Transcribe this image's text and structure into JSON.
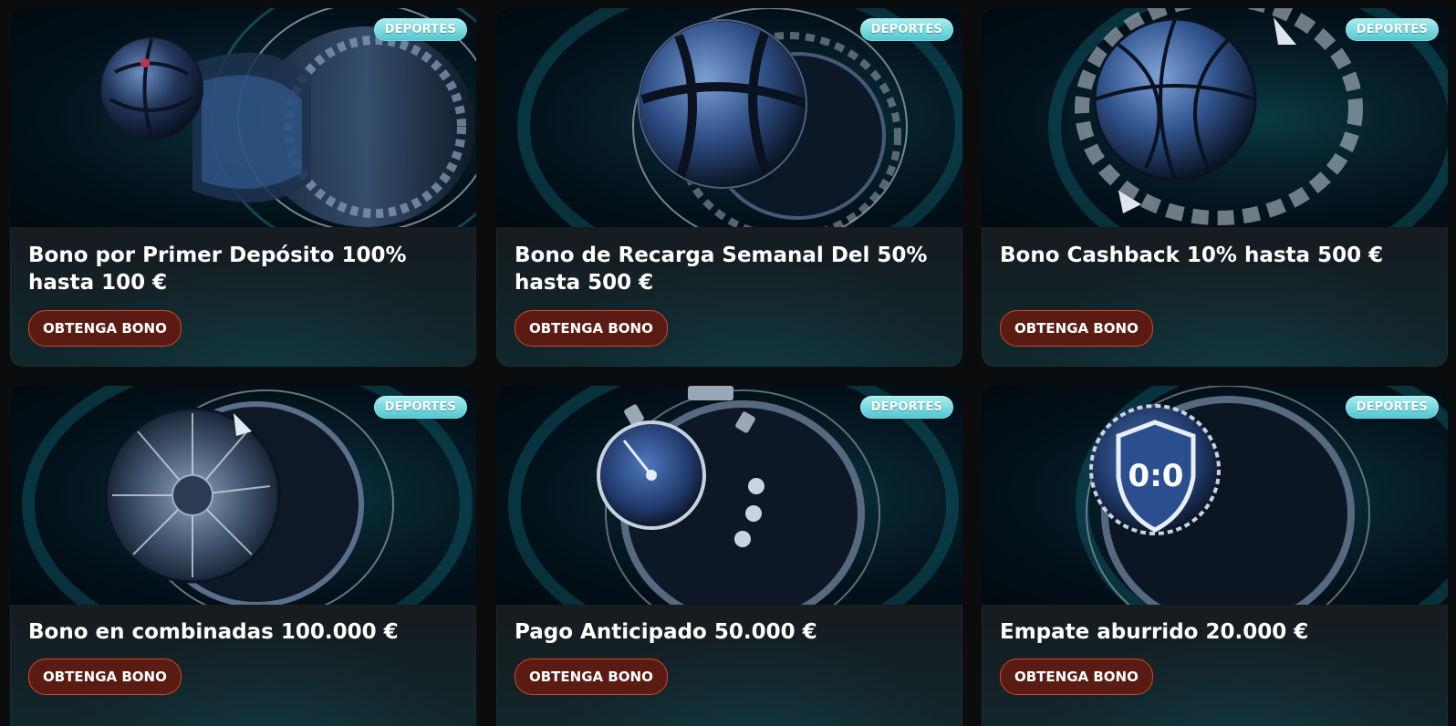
{
  "cards": [
    {
      "badge": "DEPORTES",
      "title": "Bono por Primer Depósito 100% hasta 100 €",
      "button": "OBTENGA BONO",
      "art_icon": "soccer-ball-roulette-icon"
    },
    {
      "badge": "DEPORTES",
      "title": "Bono de Recarga Semanal Del 50% hasta 500 €",
      "button": "OBTENGA BONO",
      "art_icon": "soccer-ball-icon"
    },
    {
      "badge": "DEPORTES",
      "title": "Bono Cashback 10% hasta 500 €",
      "button": "OBTENGA BONO",
      "art_icon": "basketball-icon"
    },
    {
      "badge": "DEPORTES",
      "title": "Bono en combinadas 100.000 €",
      "button": "OBTENGA BONO",
      "art_icon": "turbine-icon"
    },
    {
      "badge": "DEPORTES",
      "title": "Pago Anticipado 50.000 €",
      "button": "OBTENGA BONO",
      "art_icon": "stopwatch-icon"
    },
    {
      "badge": "DEPORTES",
      "title": "Empate aburrido 20.000 €",
      "button": "OBTENGA BONO",
      "art_icon": "shield-icon",
      "art_text": "0:0"
    }
  ],
  "colors": {
    "badge": "#5cc9d1",
    "button_bg": "#5a1c12",
    "button_border": "#d8452b",
    "page_bg": "#0b0c0e"
  }
}
